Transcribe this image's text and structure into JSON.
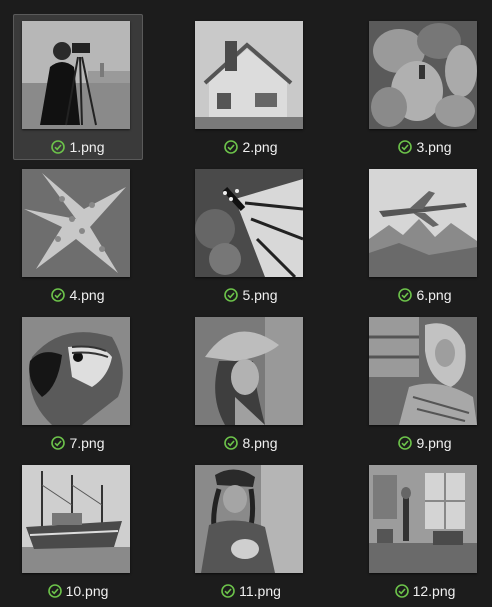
{
  "files": [
    {
      "name": "1.png",
      "status": "synced",
      "selected": true
    },
    {
      "name": "2.png",
      "status": "synced",
      "selected": false
    },
    {
      "name": "3.png",
      "status": "synced",
      "selected": false
    },
    {
      "name": "4.png",
      "status": "synced",
      "selected": false
    },
    {
      "name": "5.png",
      "status": "synced",
      "selected": false
    },
    {
      "name": "6.png",
      "status": "synced",
      "selected": false
    },
    {
      "name": "7.png",
      "status": "synced",
      "selected": false
    },
    {
      "name": "8.png",
      "status": "synced",
      "selected": false
    },
    {
      "name": "9.png",
      "status": "synced",
      "selected": false
    },
    {
      "name": "10.png",
      "status": "synced",
      "selected": false
    },
    {
      "name": "11.png",
      "status": "synced",
      "selected": false
    },
    {
      "name": "12.png",
      "status": "synced",
      "selected": false
    }
  ],
  "colors": {
    "background": "#1c1c1c",
    "selected": "#3a3a3a",
    "status_ok": "#6cc24a"
  },
  "icons": {
    "status": "check-circle-icon"
  }
}
